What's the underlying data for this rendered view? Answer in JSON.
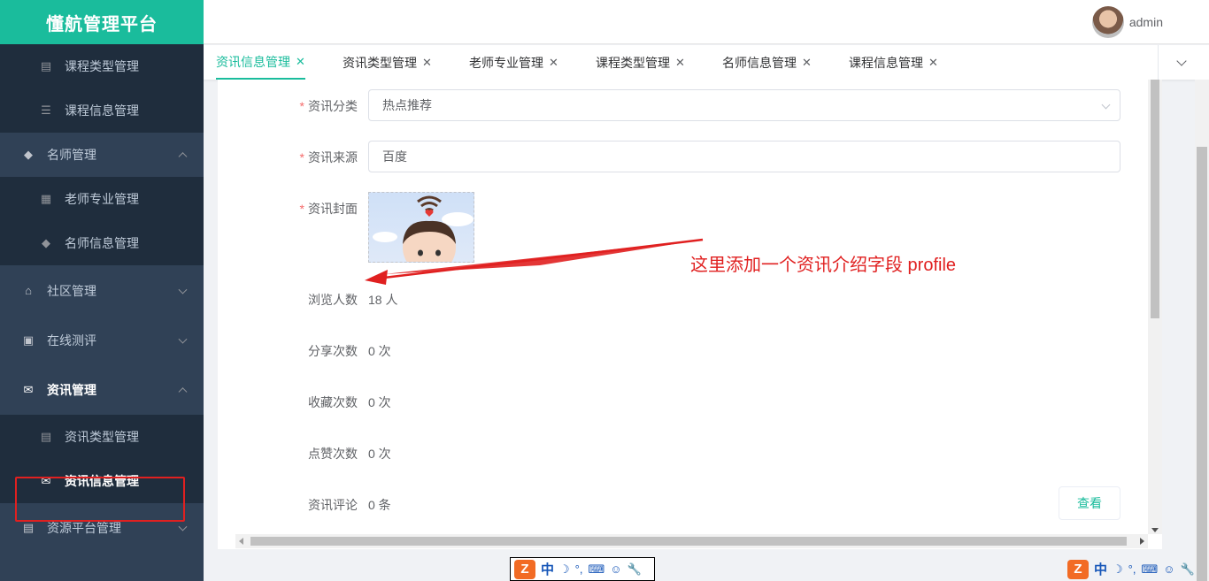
{
  "app": {
    "title": "懂航管理平台"
  },
  "header": {
    "username": "admin"
  },
  "sidebar": {
    "items": [
      {
        "label": "课程类型管理",
        "icon": "document-icon",
        "level": "sub"
      },
      {
        "label": "课程信息管理",
        "icon": "list-icon",
        "level": "sub"
      },
      {
        "label": "名师管理",
        "icon": "graduation-cap-icon",
        "level": "top",
        "expanded": true
      },
      {
        "label": "老师专业管理",
        "icon": "cabinet-icon",
        "level": "sub"
      },
      {
        "label": "名师信息管理",
        "icon": "graduation-cap-icon",
        "level": "sub"
      },
      {
        "label": "社区管理",
        "icon": "bank-icon",
        "level": "top",
        "expanded": false
      },
      {
        "label": "在线测评",
        "icon": "monitor-icon",
        "level": "top",
        "expanded": false
      },
      {
        "label": "资讯管理",
        "icon": "mail-icon",
        "level": "top",
        "expanded": true
      },
      {
        "label": "资讯类型管理",
        "icon": "doc-search-icon",
        "level": "sub"
      },
      {
        "label": "资讯信息管理",
        "icon": "mail-icon",
        "level": "sub",
        "active": true
      },
      {
        "label": "资源平台管理",
        "icon": "document-icon",
        "level": "top",
        "expanded": false
      }
    ]
  },
  "tabs": [
    {
      "label": "资讯信息管理",
      "active": true
    },
    {
      "label": "资讯类型管理",
      "active": false
    },
    {
      "label": "老师专业管理",
      "active": false
    },
    {
      "label": "课程类型管理",
      "active": false
    },
    {
      "label": "名师信息管理",
      "active": false
    },
    {
      "label": "课程信息管理",
      "active": false
    }
  ],
  "form": {
    "category": {
      "label": "资讯分类",
      "value": "热点推荐",
      "required": true
    },
    "source": {
      "label": "资讯来源",
      "value": "百度",
      "required": true
    },
    "cover": {
      "label": "资讯封面",
      "required": true
    },
    "views": {
      "label": "浏览人数",
      "value": "18 人"
    },
    "shares": {
      "label": "分享次数",
      "value": "0 次"
    },
    "favorites": {
      "label": "收藏次数",
      "value": "0 次"
    },
    "likes": {
      "label": "点赞次数",
      "value": "0 次"
    },
    "comments": {
      "label": "资讯评论",
      "value": "0 条",
      "button": "查看"
    }
  },
  "annotation": {
    "text": "这里添加一个资讯介绍字段 profile",
    "color": "#e02020"
  },
  "ime": {
    "logo": "Z",
    "lang": "中",
    "moon": "☽",
    "punct": "°,",
    "keyboard": "⌨",
    "user": "☺",
    "tool": "🔧"
  },
  "colors": {
    "accent": "#1abc9c",
    "sidebar": "#304156",
    "sidebar_sub": "#1f2d3d"
  }
}
